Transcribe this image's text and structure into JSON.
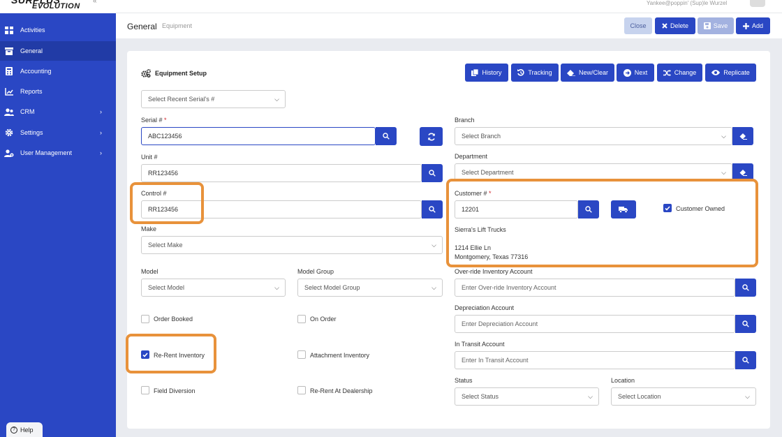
{
  "app": {
    "logo_top": "SURPLUS",
    "logo_bottom": "EVOLUTION",
    "top_user_text": "Yankee@poppin' (Sup)le Wurzel"
  },
  "sidebar": {
    "items": [
      {
        "label": "Activities"
      },
      {
        "label": "General"
      },
      {
        "label": "Accounting"
      },
      {
        "label": "Reports"
      },
      {
        "label": "CRM"
      },
      {
        "label": "Settings"
      },
      {
        "label": "User Management"
      }
    ],
    "help_label": "Help"
  },
  "header": {
    "title": "General",
    "subtitle": "Equipment",
    "buttons": {
      "close": "Close",
      "delete": "Delete",
      "save": "Save",
      "add": "Add"
    }
  },
  "setup": {
    "title": "Equipment Setup",
    "recent_serial_placeholder": "Select Recent Serial's #",
    "toolbar": {
      "history": "History",
      "tracking": "Tracking",
      "new_clear": "New/Clear",
      "next": "Next",
      "change": "Change",
      "replicate": "Replicate"
    }
  },
  "form": {
    "serial": {
      "label": "Serial #",
      "required": "*",
      "value": "ABC123456"
    },
    "unit": {
      "label": "Unit #",
      "value": "RR123456"
    },
    "control": {
      "label": "Control #",
      "value": "RR123456"
    },
    "make": {
      "label": "Make",
      "placeholder": "Select Make"
    },
    "model": {
      "label": "Model",
      "placeholder": "Select Model"
    },
    "model_group": {
      "label": "Model Group",
      "placeholder": "Select Model Group"
    },
    "branch": {
      "label": "Branch",
      "placeholder": "Select Branch"
    },
    "department": {
      "label": "Department",
      "placeholder": "Select Department"
    },
    "customer": {
      "label": "Customer #",
      "required": "*",
      "value": "12201",
      "owned_label": "Customer Owned",
      "owned_checked": true,
      "name": "Sierra's Lift Trucks",
      "address1": "1214 Ellie Ln",
      "address2": "Montgomery, Texas 77316"
    },
    "override_account": {
      "label": "Over-ride Inventory Account",
      "placeholder": "Enter Over-ride Inventory Account"
    },
    "depreciation_account": {
      "label": "Depreciation Account",
      "placeholder": "Enter Depreciation Account"
    },
    "transit_account": {
      "label": "In Transit Account",
      "placeholder": "Enter In Transit Account"
    },
    "status": {
      "label": "Status",
      "placeholder": "Select Status"
    },
    "location": {
      "label": "Location",
      "placeholder": "Select Location"
    },
    "checkboxes": {
      "order_booked": {
        "label": "Order Booked",
        "checked": false
      },
      "on_order": {
        "label": "On Order",
        "checked": false
      },
      "rerent_inventory": {
        "label": "Re-Rent Inventory",
        "checked": true
      },
      "attachment_inventory": {
        "label": "Attachment Inventory",
        "checked": false
      },
      "field_diversion": {
        "label": "Field Diversion",
        "checked": false
      },
      "rerent_dealership": {
        "label": "Re-Rent At Dealership",
        "checked": false
      }
    }
  },
  "colors": {
    "primary": "#2a47c4",
    "highlight": "#e8923b",
    "required": "#d0242b"
  }
}
